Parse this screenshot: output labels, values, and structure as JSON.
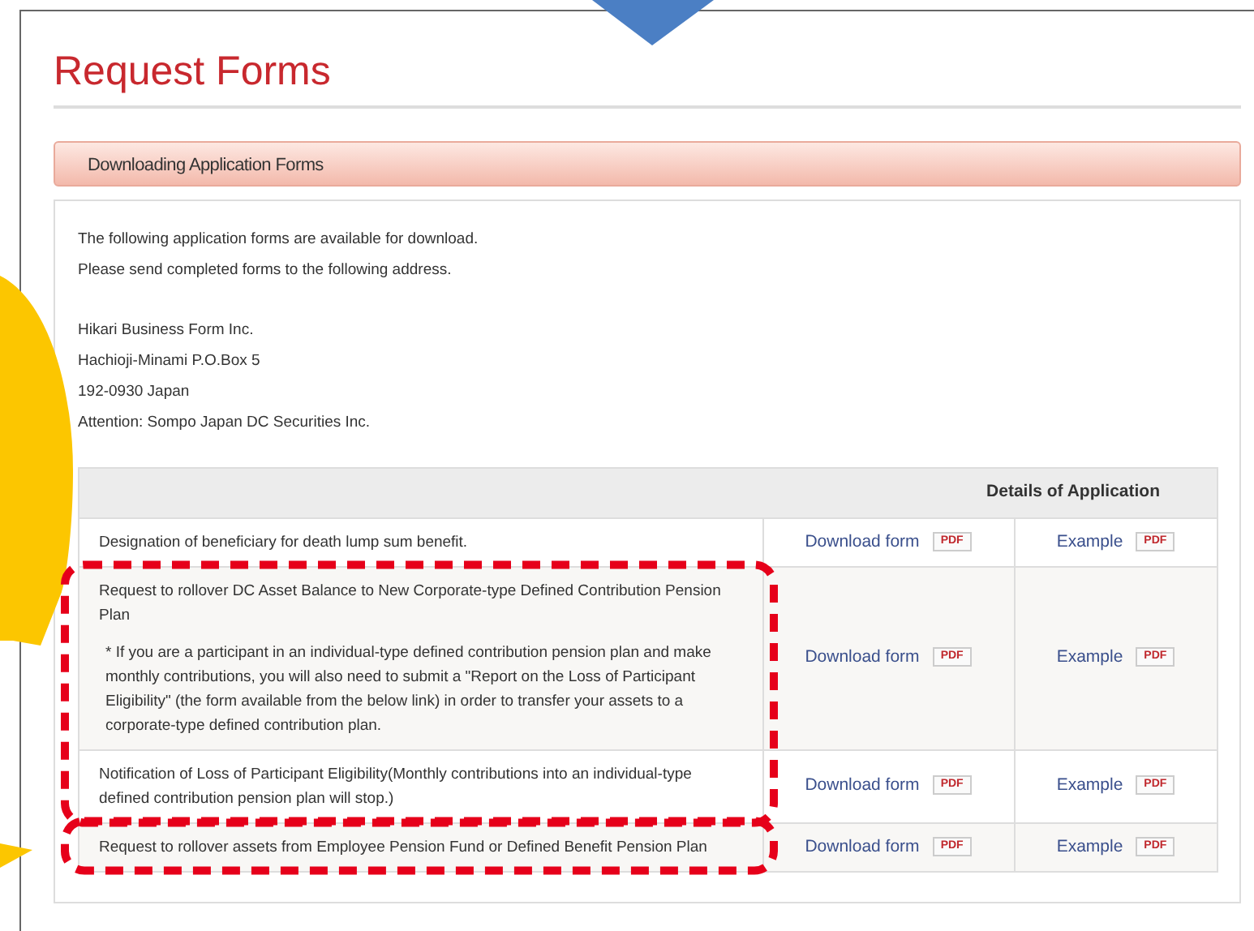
{
  "title": "Request Forms",
  "section_header": "Downloading Application Forms",
  "intro": [
    "The following application forms are available for download.",
    "Please send completed forms to the following address."
  ],
  "address": [
    "Hikari Business Form Inc.",
    "Hachioji-Minami P.O.Box 5",
    "192-0930 Japan",
    "Attention: Sompo Japan DC Securities Inc."
  ],
  "table": {
    "header": "Details of Application",
    "rows": [
      {
        "title": "Designation of beneficiary for death lump sum benefit.",
        "download": "Download form",
        "download_badge": "PDF",
        "example": "Example",
        "example_badge": "PDF"
      },
      {
        "title": "Request to rollover DC Asset Balance to New Corporate-type Defined Contribution Pension Plan",
        "note": "* If you are a participant in an individual-type defined contribution pension plan and make monthly contributions, you will also need to submit a \"Report on the Loss of Participant Eligibility\" (the form available from the below link) in order to transfer your assets to a corporate-type defined contribution plan.",
        "download": "Download form",
        "download_badge": "PDF",
        "example": "Example",
        "example_badge": "PDF"
      },
      {
        "title": "Notification of Loss of Participant Eligibility(Monthly contributions into an individual-type defined contribution pension plan will stop.)",
        "download": "Download form",
        "download_badge": "PDF",
        "example": "Example",
        "example_badge": "PDF"
      },
      {
        "title": "Request to rollover assets from Employee Pension Fund or Defined Benefit Pension Plan",
        "download": "Download form",
        "download_badge": "PDF",
        "example": "Example",
        "example_badge": "PDF"
      }
    ]
  }
}
